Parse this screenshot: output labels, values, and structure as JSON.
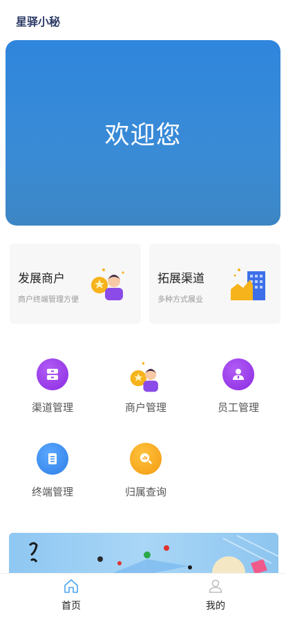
{
  "header": {
    "app_title": "星驿小秘"
  },
  "hero": {
    "welcome_text": "欢迎您",
    "color_top": "#2f86dc",
    "color_bottom": "#3c86c4"
  },
  "cards": [
    {
      "title": "发展商户",
      "subtitle": "商户终端管理方便",
      "icon": "merchant-person-icon"
    },
    {
      "title": "拓展渠道",
      "subtitle": "多种方式展业",
      "icon": "building-chart-icon"
    }
  ],
  "grid": [
    {
      "label": "渠道管理",
      "icon": "drawer-icon",
      "color": "#9b3be8"
    },
    {
      "label": "商户管理",
      "icon": "merchant-person-icon",
      "color": "#f6b31b"
    },
    {
      "label": "员工管理",
      "icon": "employee-icon",
      "color": "#9b3be8"
    },
    {
      "label": "终端管理",
      "icon": "document-icon",
      "color": "#3b8ff0"
    },
    {
      "label": "归属查询",
      "icon": "search-chart-icon",
      "color": "#f6a81b"
    }
  ],
  "tabbar": {
    "items": [
      {
        "label": "首页",
        "icon": "home-icon",
        "active": true
      },
      {
        "label": "我的",
        "icon": "user-icon",
        "active": false
      }
    ]
  }
}
